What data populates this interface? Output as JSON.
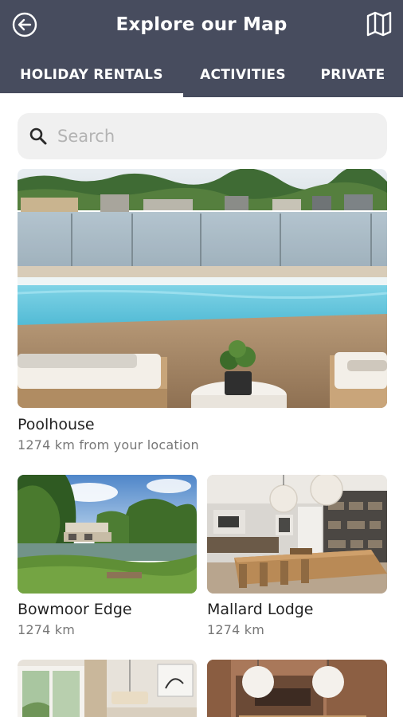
{
  "header": {
    "title": "Explore our Map",
    "back_icon": "back-circle-arrow-icon",
    "map_icon": "folded-map-icon",
    "bg_color": "#474c5e"
  },
  "tabs": [
    {
      "label": "HOLIDAY RENTALS",
      "active": true
    },
    {
      "label": "ACTIVITIES",
      "active": false
    },
    {
      "label": "PRIVATE",
      "active": false
    }
  ],
  "search": {
    "placeholder": "Search",
    "value": ""
  },
  "listings": [
    {
      "name": "Poolhouse",
      "distance": "1274 km from your location"
    },
    {
      "name": "Bowmoor Edge",
      "distance": "1274 km"
    },
    {
      "name": "Mallard Lodge",
      "distance": "1274 km"
    }
  ]
}
